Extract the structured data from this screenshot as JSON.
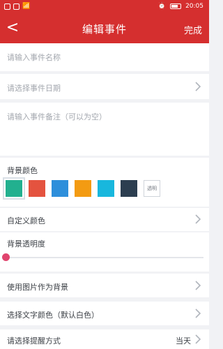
{
  "statusbar": {
    "time": "20:05"
  },
  "header": {
    "back_label": "<",
    "title": "编辑事件",
    "done_label": "完成"
  },
  "fields": {
    "event_name_placeholder": "请输入事件名称",
    "event_date_label": "请选择事件日期",
    "remark_placeholder": "请输入事件备注（可以为空）"
  },
  "background": {
    "label": "背景颜色",
    "colors": [
      "#22b08f",
      "#e4533f",
      "#2e8fdb",
      "#f39b12",
      "#18b7dd",
      "#2c3e50"
    ],
    "transparent_label": "透明"
  },
  "custom_color_label": "自定义颜色",
  "transparency": {
    "label": "背景透明度",
    "value": 0
  },
  "image_bg_label": "使用图片作为背景",
  "text_color_label": "选择文字颜色（默认白色）",
  "reminder": {
    "label": "请选择提醒方式",
    "value": "当天"
  }
}
